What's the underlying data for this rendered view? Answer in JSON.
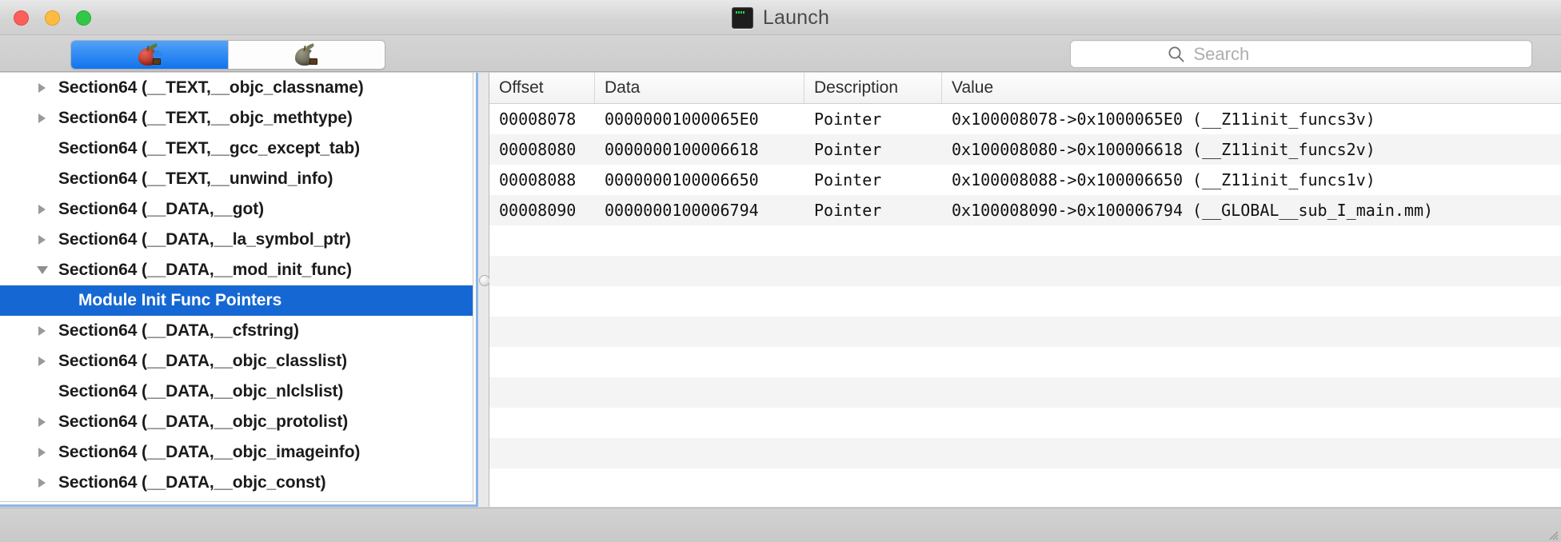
{
  "window": {
    "title": "Launch",
    "title_icon": "terminal-icon",
    "traffic_lights": [
      {
        "name": "close",
        "color": "#fc6058"
      },
      {
        "name": "minimize",
        "color": "#fdbc40"
      },
      {
        "name": "maximize",
        "color": "#33c748"
      }
    ]
  },
  "toolbar": {
    "segmented": [
      {
        "name": "apple-red-icon",
        "label": "",
        "selected": true
      },
      {
        "name": "apple-grey-icon",
        "label": "",
        "selected": false
      }
    ],
    "search": {
      "icon": "search-icon",
      "value": "",
      "placeholder": "Search"
    }
  },
  "sidebar": {
    "selection_color": "#1568d3",
    "items": [
      {
        "label": "Section64 (__TEXT,__objc_classname)",
        "disclosure": "collapsed",
        "level": 0,
        "selected": false
      },
      {
        "label": "Section64 (__TEXT,__objc_methtype)",
        "disclosure": "collapsed",
        "level": 0,
        "selected": false
      },
      {
        "label": "Section64 (__TEXT,__gcc_except_tab)",
        "disclosure": "none",
        "level": 0,
        "selected": false
      },
      {
        "label": "Section64 (__TEXT,__unwind_info)",
        "disclosure": "none",
        "level": 0,
        "selected": false
      },
      {
        "label": "Section64 (__DATA,__got)",
        "disclosure": "collapsed",
        "level": 0,
        "selected": false
      },
      {
        "label": "Section64 (__DATA,__la_symbol_ptr)",
        "disclosure": "collapsed",
        "level": 0,
        "selected": false
      },
      {
        "label": "Section64 (__DATA,__mod_init_func)",
        "disclosure": "expanded",
        "level": 0,
        "selected": false
      },
      {
        "label": "Module Init Func Pointers",
        "disclosure": "none",
        "level": 1,
        "selected": true
      },
      {
        "label": "Section64 (__DATA,__cfstring)",
        "disclosure": "collapsed",
        "level": 0,
        "selected": false
      },
      {
        "label": "Section64 (__DATA,__objc_classlist)",
        "disclosure": "collapsed",
        "level": 0,
        "selected": false
      },
      {
        "label": "Section64 (__DATA,__objc_nlclslist)",
        "disclosure": "none",
        "level": 0,
        "selected": false
      },
      {
        "label": "Section64 (__DATA,__objc_protolist)",
        "disclosure": "collapsed",
        "level": 0,
        "selected": false
      },
      {
        "label": "Section64 (__DATA,__objc_imageinfo)",
        "disclosure": "collapsed",
        "level": 0,
        "selected": false
      },
      {
        "label": "Section64 (__DATA,__objc_const)",
        "disclosure": "collapsed",
        "level": 0,
        "selected": false
      }
    ]
  },
  "table": {
    "columns": [
      "Offset",
      "Data",
      "Description",
      "Value"
    ],
    "rows": [
      {
        "offset": "00008078",
        "data": "00000001000065E0",
        "description": "Pointer",
        "value": "0x100008078->0x1000065E0 (__Z11init_funcs3v)"
      },
      {
        "offset": "00008080",
        "data": "0000000100006618",
        "description": "Pointer",
        "value": "0x100008080->0x100006618 (__Z11init_funcs2v)"
      },
      {
        "offset": "00008088",
        "data": "0000000100006650",
        "description": "Pointer",
        "value": "0x100008088->0x100006650 (__Z11init_funcs1v)"
      },
      {
        "offset": "00008090",
        "data": "0000000100006794",
        "description": "Pointer",
        "value": "0x100008090->0x100006794 (__GLOBAL__sub_I_main.mm)"
      }
    ],
    "empty_row_count": 9
  },
  "statusbar": {
    "text": ""
  }
}
